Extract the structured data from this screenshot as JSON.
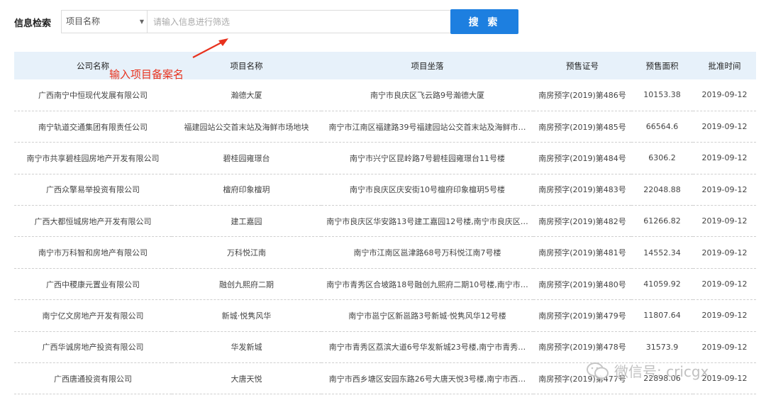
{
  "search": {
    "label": "信息检索",
    "select_value": "项目名称",
    "placeholder": "请输入信息进行筛选",
    "button_label": "搜 索"
  },
  "annotation": {
    "text": "输入项目备案名"
  },
  "table": {
    "columns": [
      "公司名称",
      "项目名称",
      "项目坐落",
      "预售证号",
      "预售面积",
      "批准时间"
    ],
    "rows": [
      [
        "广西南宁中恒现代发展有限公司",
        "瀚德大厦",
        "南宁市良庆区飞云路9号瀚德大厦",
        "南房预字(2019)第486号",
        "10153.38",
        "2019-09-12"
      ],
      [
        "南宁轨道交通集团有限责任公司",
        "福建园站公交首末站及海鲜市场地块",
        "南宁市江南区福建路39号福建园站公交首末站及海鲜市…",
        "南房预字(2019)第485号",
        "66564.6",
        "2019-09-12"
      ],
      [
        "南宁市共享碧桂园房地产开发有限公司",
        "碧桂园雍璟台",
        "南宁市兴宁区昆岭路7号碧桂园雍璟台11号楼",
        "南房预字(2019)第484号",
        "6306.2",
        "2019-09-12"
      ],
      [
        "广西众擎易举投资有限公司",
        "檀府印象檀玥",
        "南宁市良庆区庆安街10号檀府印象檀玥5号楼",
        "南房预字(2019)第483号",
        "22048.88",
        "2019-09-12"
      ],
      [
        "广西大都恒城房地产开发有限公司",
        "建工嘉园",
        "南宁市良庆区华安路13号建工嘉园12号楼,南宁市良庆区…",
        "南房预字(2019)第482号",
        "61266.82",
        "2019-09-12"
      ],
      [
        "南宁市万科智和房地产有限公司",
        "万科悦江南",
        "南宁市江南区邕津路68号万科悦江南7号楼",
        "南房预字(2019)第481号",
        "14552.34",
        "2019-09-12"
      ],
      [
        "广西中稷康元置业有限公司",
        "融创九熙府二期",
        "南宁市青秀区合坡路18号融创九熙府二期10号楼,南宁市…",
        "南房预字(2019)第480号",
        "41059.92",
        "2019-09-12"
      ],
      [
        "南宁亿文房地产开发有限公司",
        "新城·悦隽风华",
        "南宁市邕宁区新邕路3号新城·悦隽风华12号楼",
        "南房预字(2019)第479号",
        "11807.64",
        "2019-09-12"
      ],
      [
        "广西华诚房地产投资有限公司",
        "华发新城",
        "南宁市青秀区荔滨大道6号华发新城23号楼,南宁市青秀…",
        "南房预字(2019)第478号",
        "31573.9",
        "2019-09-12"
      ],
      [
        "广西唐通投资有限公司",
        "大唐天悦",
        "南宁市西乡塘区安园东路26号大唐天悦3号楼,南宁市西…",
        "南房预字(2019)第477号",
        "22898.06",
        "2019-09-12"
      ]
    ]
  },
  "watermark": {
    "text": "微信号: cricgx"
  },
  "colors": {
    "accent": "#1d7fe0",
    "header_bg": "#e7f1fa",
    "annotation": "#e8321e"
  }
}
